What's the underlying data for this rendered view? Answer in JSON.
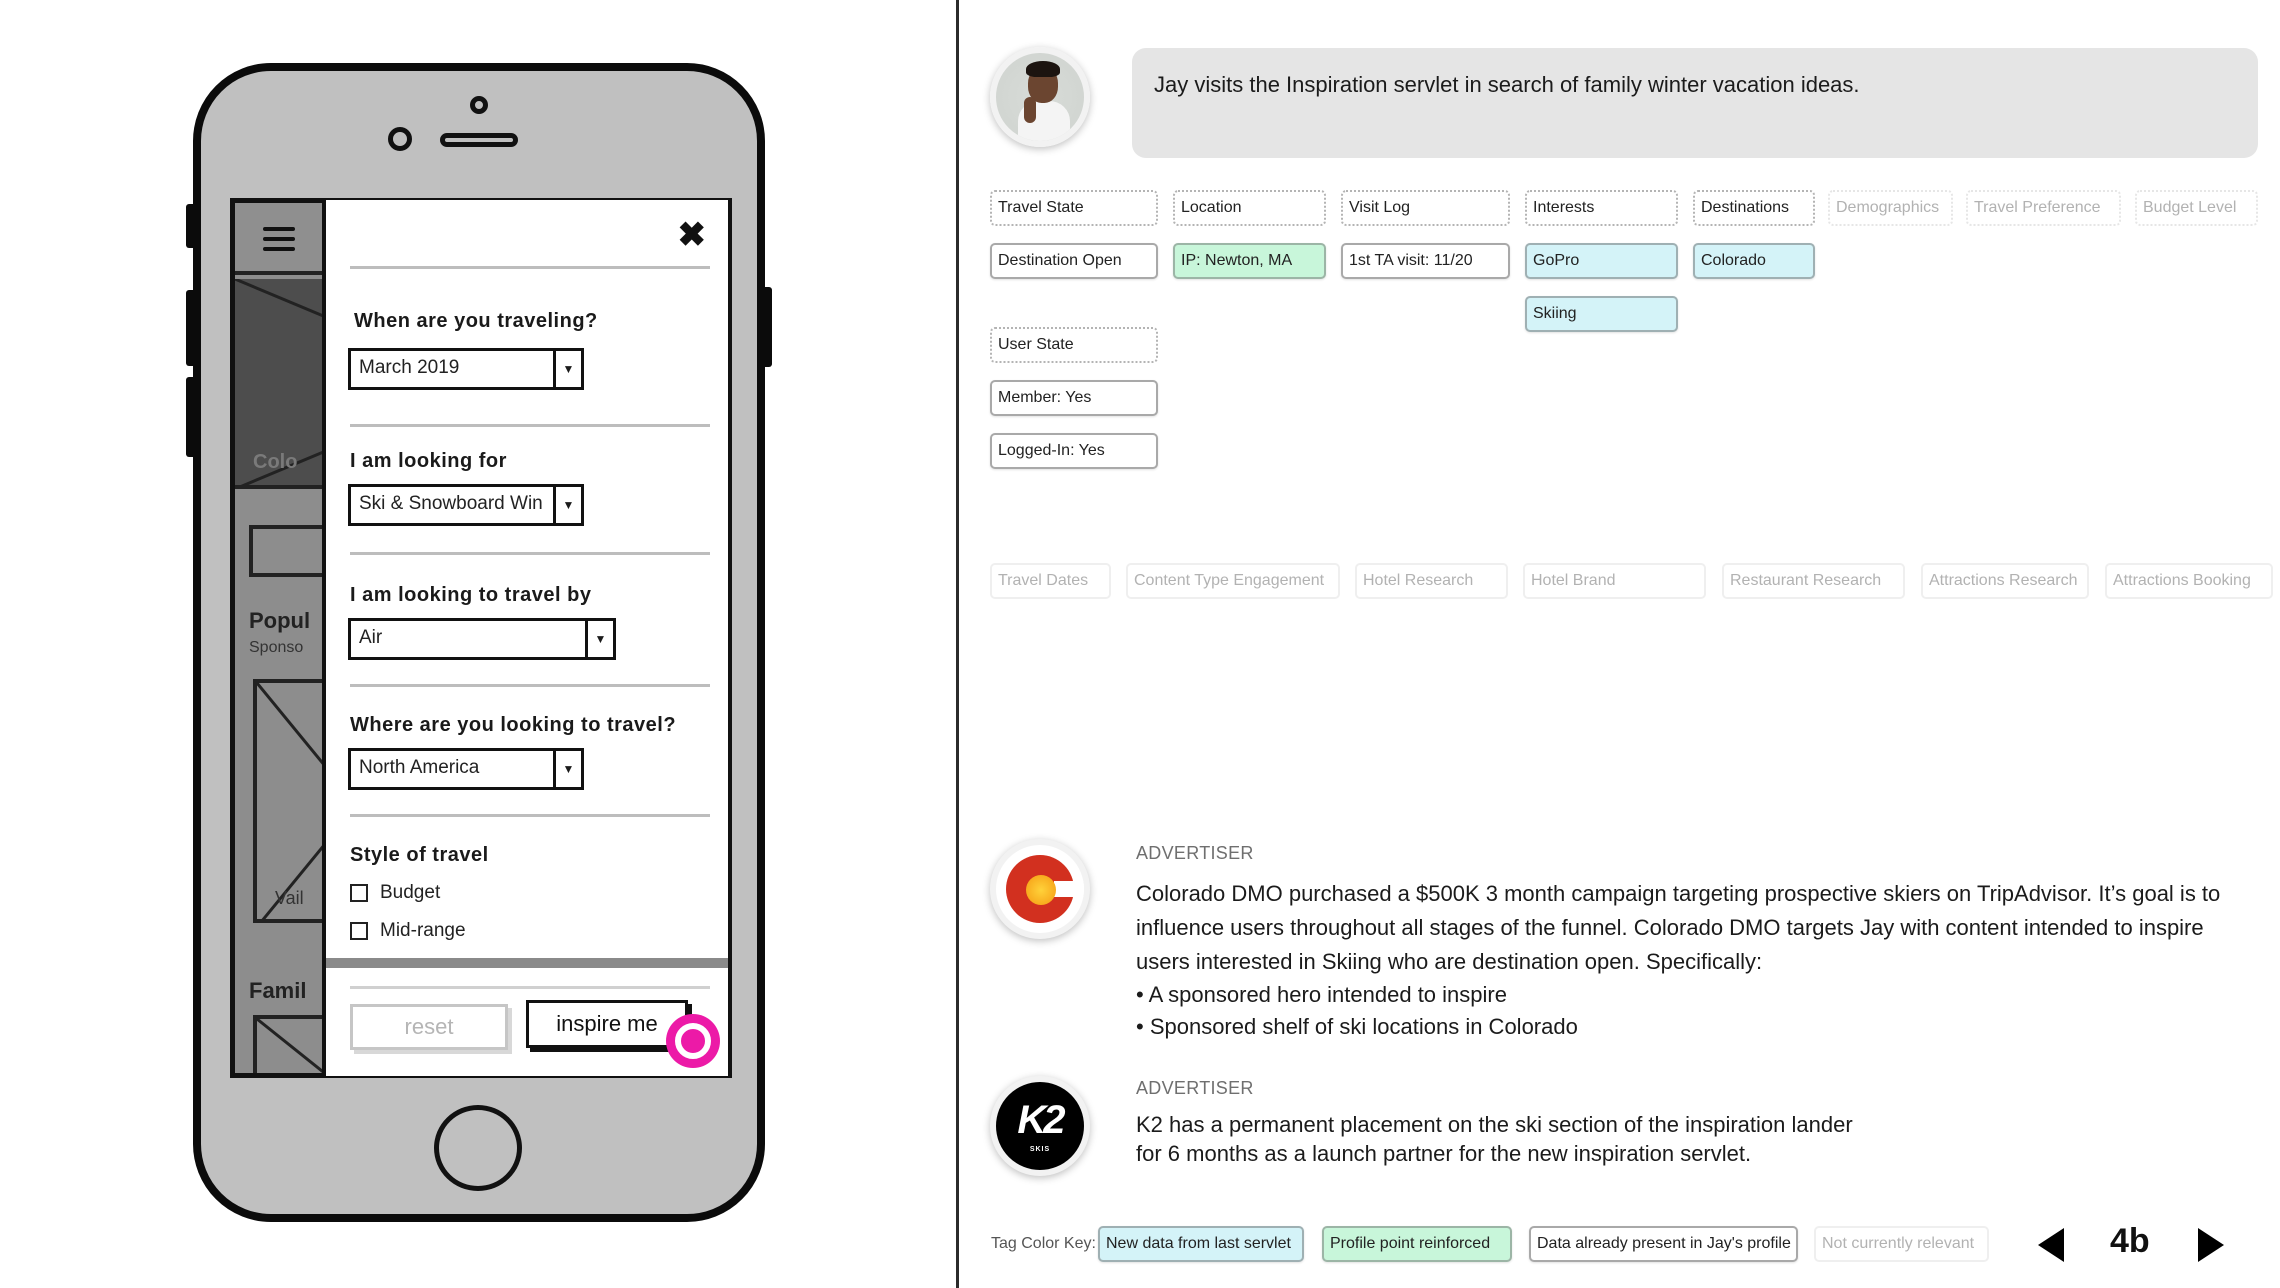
{
  "phone": {
    "background_page": {
      "location_label": "Colo",
      "section1_title": "Popul",
      "section1_subtitle": "Sponso",
      "card1_label": "Vail",
      "section2_title": "Famil"
    },
    "modal": {
      "close_icon": "close-x-icon",
      "questions": [
        {
          "label": "When are you traveling?",
          "value": "March 2019"
        },
        {
          "label": "I am looking for",
          "value": "Ski & Snowboard Win"
        },
        {
          "label": "I am looking to travel by",
          "value": "Air"
        },
        {
          "label": "Where are you looking to travel?",
          "value": "North America"
        }
      ],
      "style_label": "Style of travel",
      "style_options": [
        {
          "label": "Budget",
          "checked": false
        },
        {
          "label": "Mid-range",
          "checked": false
        }
      ],
      "reset_label": "reset",
      "inspire_label": "inspire me"
    }
  },
  "persona": {
    "name": "Jay",
    "narrative": "Jay visits the Inspiration servlet in search of family winter vacation ideas."
  },
  "tags": {
    "headers": [
      {
        "label": "Travel State",
        "status": "relevant"
      },
      {
        "label": "Location",
        "status": "relevant"
      },
      {
        "label": "Visit Log",
        "status": "relevant"
      },
      {
        "label": "Interests",
        "status": "relevant"
      },
      {
        "label": "Destinations",
        "status": "relevant"
      },
      {
        "label": "Demographics",
        "status": "not_relevant"
      },
      {
        "label": "Travel Preference",
        "status": "not_relevant"
      },
      {
        "label": "Budget Level",
        "status": "not_relevant"
      }
    ],
    "values": {
      "travel_state": {
        "label": "Destination Open",
        "status": "present"
      },
      "location": {
        "label": "IP: Newton, MA",
        "status": "reinforced"
      },
      "visit_log": {
        "label": "1st TA visit: 11/20",
        "status": "present"
      },
      "interests": [
        {
          "label": "GoPro",
          "status": "new"
        },
        {
          "label": "Skiing",
          "status": "new"
        }
      ],
      "destinations": {
        "label": "Colorado",
        "status": "new"
      }
    },
    "user_state": {
      "header": "User State",
      "values": [
        {
          "label": "Member: Yes",
          "status": "present"
        },
        {
          "label": "Logged-In: Yes",
          "status": "present"
        }
      ]
    },
    "other_categories": [
      "Travel Dates",
      "Content Type Engagement",
      "Hotel Research",
      "Hotel Brand",
      "Restaurant Research",
      "Attractions Research",
      "Attractions Booking"
    ]
  },
  "advertisers": [
    {
      "label": "ADVERTISER",
      "logo": "colorado-c-logo",
      "text": "Colorado DMO purchased a $500K 3 month campaign targeting prospective skiers on TripAdvisor. It’s goal is to influence users throughout all stages of the funnel. Colorado DMO targets Jay with content intended to inspire users interested in Skiing who are destination open. Specifically:",
      "bullets": [
        "• A sponsored hero intended to inspire",
        "• Sponsored shelf of ski locations in Colorado"
      ]
    },
    {
      "label": "ADVERTISER",
      "logo": "k2-skis-logo",
      "logo_text": "K2",
      "logo_subtext": "SKIS",
      "text_lines": [
        "K2 has a permanent placement on the ski section of the inspiration lander",
        "for 6 months as a launch partner for the new inspiration servlet."
      ]
    }
  ],
  "legend": {
    "label": "Tag Color Key:",
    "items": [
      {
        "label": "New data from last servlet",
        "color": "#d4f3f8"
      },
      {
        "label": "Profile point reinforced",
        "color": "#c8f6da"
      },
      {
        "label": "Data already present in Jay's profile",
        "color": "#ffffff"
      },
      {
        "label": "Not currently relevant",
        "color": "#ffffff"
      }
    ]
  },
  "pager": {
    "current": "4b"
  },
  "colors": {
    "tap_indicator": "#ec1aa7",
    "new_data": "#d4f3f8",
    "reinforced": "#c8f6da",
    "bubble": "#e5e5e5"
  }
}
